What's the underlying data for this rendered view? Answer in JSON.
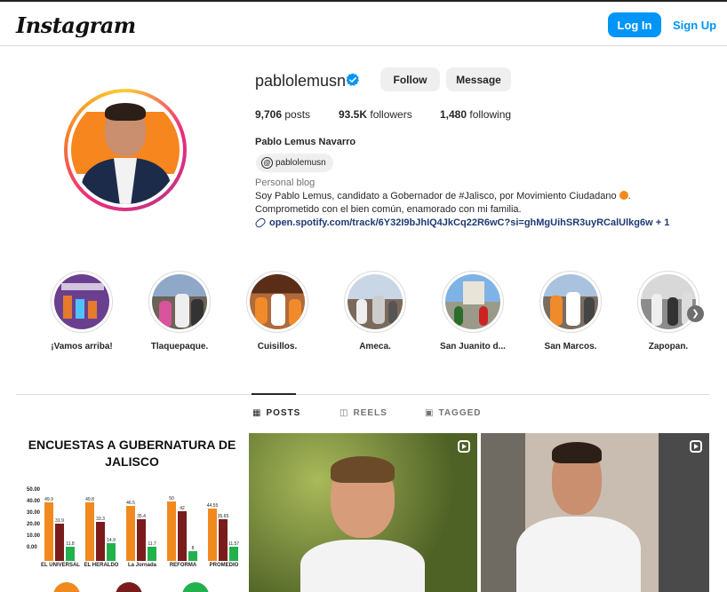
{
  "app": {
    "logo": "Instagram",
    "login_label": "Log In",
    "signup_label": "Sign Up"
  },
  "colors": {
    "accent": "#0095f6",
    "verified": "#0095f6",
    "link": "#1d3a73"
  },
  "profile": {
    "username": "pablolemusn",
    "verified": true,
    "follow_label": "Follow",
    "message_label": "Message",
    "stats": {
      "posts": "9,706",
      "posts_label": "posts",
      "followers": "93.5K",
      "followers_label": "followers",
      "following": "1,480",
      "following_label": "following"
    },
    "full_name": "Pablo Lemus Navarro",
    "threads_handle": "pablolemusn",
    "category": "Personal blog",
    "bio_line1": "Soy Pablo Lemus, candidato a Gobernador de #Jalisco, por Movimiento Ciudadano",
    "bio_line1_end": ".",
    "bio_line2": "Comprometido con el bien común, enamorado con mi familia.",
    "link": "open.spotify.com/track/6Y32I9bJhIQ4JkCq22R6wC?si=ghMgUihSR3uyRCalUlkg6w + 1"
  },
  "highlights": [
    {
      "label": "¡Vamos arriba!"
    },
    {
      "label": "Tlaquepaque."
    },
    {
      "label": "Cuisillos."
    },
    {
      "label": "Ameca."
    },
    {
      "label": "San Juanito d..."
    },
    {
      "label": "San Marcos."
    },
    {
      "label": "Zapopan."
    }
  ],
  "tabs": [
    {
      "label": "POSTS",
      "icon": "grid-icon",
      "active": true
    },
    {
      "label": "REELS",
      "icon": "reels-icon",
      "active": false
    },
    {
      "label": "TAGGED",
      "icon": "tagged-icon",
      "active": false
    }
  ],
  "posts": {
    "post1": {
      "title": "ENCUESTAS A GUBERNATURA DE JALISCO",
      "yticks": [
        "50.00",
        "40.00",
        "30.00",
        "20.00",
        "10.00",
        "0.00"
      ],
      "groups": [
        {
          "paper": "EL UNIVERSAL",
          "values": [
            "49.9",
            "31.9",
            "11.8"
          ]
        },
        {
          "paper": "EL HERALDO",
          "values": [
            "49.8",
            "33.3",
            "14.9"
          ]
        },
        {
          "paper": "La Jornada",
          "values": [
            "46.5",
            "35.4",
            "11.7"
          ]
        },
        {
          "paper": "REFORMA",
          "values": [
            "50",
            "42",
            "8"
          ]
        },
        {
          "paper": "PROMEDIO",
          "values": [
            "44.55",
            "35.65",
            "11.57"
          ]
        }
      ]
    }
  }
}
